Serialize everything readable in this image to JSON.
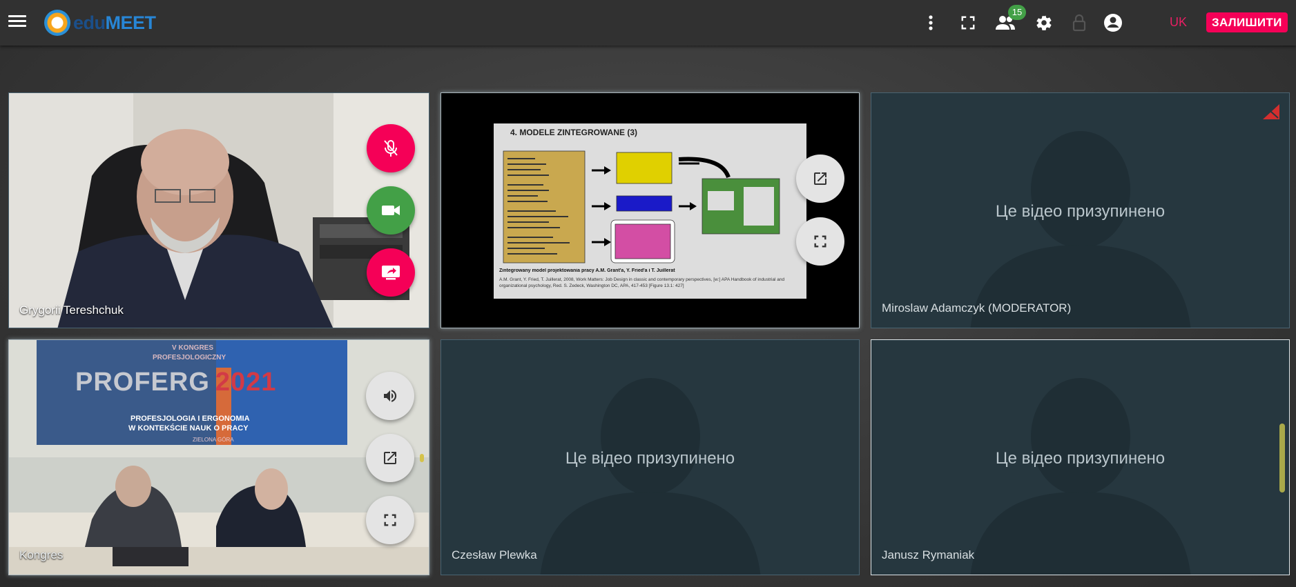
{
  "app": {
    "brand_prefix": "edu",
    "brand_suffix": "MEET",
    "participants_count": "15",
    "language": "UK",
    "leave_label": "ЗАЛИШИТИ"
  },
  "colors": {
    "accent_pink": "#f50057",
    "accent_green": "#43a047",
    "topbar": "#313131",
    "tile_bg": "#26373f"
  },
  "topbar_icons": [
    "menu-icon",
    "more-vert-icon",
    "fullscreen-icon",
    "participants-icon",
    "settings-icon",
    "lock-icon",
    "account-icon"
  ],
  "tiles": [
    {
      "name": "Grygorii Tereshchuk",
      "controls": [
        "mic-off-icon",
        "videocam-icon",
        "screen-share-icon"
      ]
    },
    {
      "name": "",
      "controls": [
        "open-in-new-icon",
        "fullscreen-icon"
      ],
      "slide": {
        "title": "4. MODELE ZINTEGROWANE (3)",
        "caption": "Zintegrowany model projektowania pracy A.M. Grant'a, Y. Fried'a i T. Juillerat",
        "citation": "A.M. Grant, Y. Fried, T. Juillerat, 2008, Work Matters: Job Design in classic and contemporary perspectives, [w:] APA Handbook of industrial and organizational psychology, Red. S. Zedeck, Washington DC, APA, 417-453 [Figure 13.1: 427]"
      }
    },
    {
      "name": "Miroslaw Adamczyk (MODERATOR)",
      "paused": "Це відео призупинено"
    },
    {
      "name": "Kongres",
      "controls": [
        "volume-up-icon",
        "open-in-new-icon",
        "fullscreen-icon"
      ],
      "banner": {
        "line1": "V KONGRES",
        "line2": "PROFESJOLOGICZNY",
        "title": "PROFERG",
        "year": "2021",
        "sub1": "PROFESJOLOGIA I ERGONOMIA",
        "sub2": "W KONTEKŚCIE NAUK O PRACY",
        "place": "ZIELONA GÓRA"
      }
    },
    {
      "name": "Czesław Plewka",
      "paused": "Це відео призупинено"
    },
    {
      "name": "Janusz Rymaniak",
      "paused": "Це відео призупинено"
    }
  ]
}
